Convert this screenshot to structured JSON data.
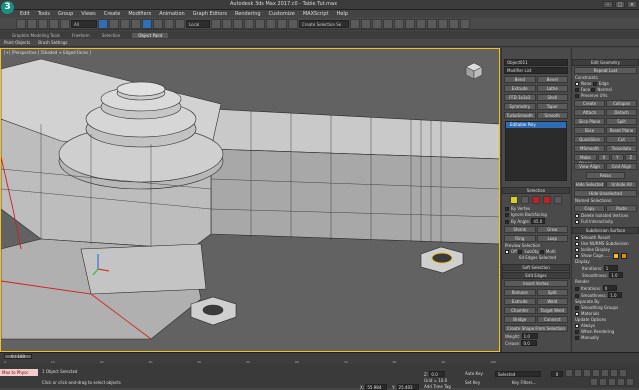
{
  "app": {
    "title": "Autodesk 3ds Max 2017.c0 - Table Tut.max",
    "logo_letter": "3"
  },
  "menu": [
    "Edit",
    "Tools",
    "Group",
    "Views",
    "Create",
    "Modifiers",
    "Animation",
    "Graph Editors",
    "Rendering",
    "Customize",
    "MAXScript",
    "Help"
  ],
  "toolbar": {
    "filter_value": "All",
    "coord_value": "Local",
    "selection_set": "Create Selection Se"
  },
  "ribbon": {
    "tabs": [
      "Graphite Modeling Tools",
      "Freeform",
      "Selection",
      "Object Paint"
    ],
    "active_tab": "Object Paint",
    "subtabs": [
      "Paint Objects",
      "Brush Settings"
    ]
  },
  "viewport": {
    "label": "[+] [Perspective ] [Shaded + Edged Faces ]",
    "border_color": "#f0c020"
  },
  "command_panel": {
    "object_name": "Object011",
    "modifier_list": "Modifier List",
    "modifier_buttons": [
      [
        "Bend",
        "Bevel"
      ],
      [
        "Extrude",
        "Lathe"
      ],
      [
        "FFD 3x3x3",
        "Shell"
      ],
      [
        "Symmetry",
        "Taper"
      ],
      [
        "TurboSmooth",
        "Smooth"
      ]
    ],
    "stack_item": "Editable Poly",
    "selection": {
      "header": "Selection",
      "by_vertex": "By Vertex",
      "ignore_backfacing": "Ignore Backfacing",
      "by_angle": "By Angle:",
      "angle_value": "45.0",
      "shrink": "Shrink",
      "grow": "Grow",
      "ring": "Ring",
      "loop": "Loop",
      "preview": "Preview Selection",
      "preview_off": "Off",
      "preview_subobj": "SubObj",
      "preview_multi": "Multi",
      "status": "64 Edges Selected"
    },
    "soft_selection": "Soft Selection",
    "edit_edges": {
      "header": "Edit Edges",
      "insert_vertex": "Insert Vertex",
      "remove": "Remove",
      "split": "Split",
      "extrude": "Extrude",
      "weld": "Weld",
      "chamfer": "Chamfer",
      "target_weld": "Target Weld",
      "bridge": "Bridge",
      "connect": "Connect",
      "create_shape": "Create Shape From Selection",
      "weight_label": "Weight:",
      "weight_value": "1.0",
      "crease_label": "Crease:",
      "crease_value": "0.0"
    }
  },
  "edit_geometry": {
    "header": "Edit Geometry",
    "repeat_last": "Repeat Last",
    "constraints": "Constraints",
    "none": "None",
    "edge": "Edge",
    "face": "Face",
    "normal": "Normal",
    "preserve_uvs": "Preserve UVs",
    "create": "Create",
    "collapse": "Collapse",
    "attach": "Attach",
    "detach": "Detach",
    "slice_plane": "Slice Plane",
    "split": "Split",
    "slice": "Slice",
    "reset_plane": "Reset Plane",
    "quickslice": "QuickSlice",
    "cut": "Cut",
    "msmooth": "MSmooth",
    "tessellate": "Tessellate",
    "make_planar": "Make Planar",
    "x": "X",
    "y": "Y",
    "z": "Z",
    "view_align": "View Align",
    "grid_align": "Grid Align",
    "relax": "Relax",
    "hide_selected": "Hide Selected",
    "unhide_all": "Unhide All",
    "hide_unselected": "Hide Unselected",
    "named_selections": "Named Selections:",
    "copy": "Copy",
    "paste": "Paste",
    "delete_isolated": "Delete Isolated Vertices",
    "full_interactivity": "Full Interactivity",
    "subdivision_surface": "Subdivision Surface",
    "smooth_result": "Smooth Result",
    "use_nurms": "Use NURMS Subdivision",
    "isoline_display": "Isoline Display",
    "show_cage": "Show Cage......",
    "cage_color1": "#f0c020",
    "cage_color2": "#e08a10",
    "display": "Display",
    "iterations_label": "Iterations:",
    "iterations_value": "1",
    "smoothness_label": "Smoothness:",
    "smoothness_value": "1.0",
    "render": "Render",
    "r_iterations_value": "0",
    "r_smoothness_value": "1.0",
    "separate_by": "Separate By",
    "smoothing_groups": "Smoothing Groups",
    "materials": "Materials",
    "update_options": "Update Options",
    "always": "Always",
    "when_rendering": "When Rendering",
    "manually": "Manually"
  },
  "timeline": {
    "slider": "0 / 100",
    "ticks": [
      "0",
      "10",
      "20",
      "30",
      "40",
      "50",
      "60",
      "70",
      "80",
      "90",
      "100"
    ]
  },
  "status": {
    "maxscript": "Max to Physc",
    "objects_selected": "1 Object Selected",
    "hint": "Click or click-and-drag to select objects",
    "x_label": "X:",
    "x_value": "55.984",
    "y_label": "Y:",
    "y_value": "25.403",
    "z_label": "Z:",
    "z_value": "0.0",
    "grid": "Grid = 10.0",
    "add_time_tag": "Add Time Tag",
    "auto_key": "Auto Key",
    "selected": "Selected",
    "set_key": "Set Key",
    "key_filters": "Key Filters...",
    "frame": "0"
  }
}
